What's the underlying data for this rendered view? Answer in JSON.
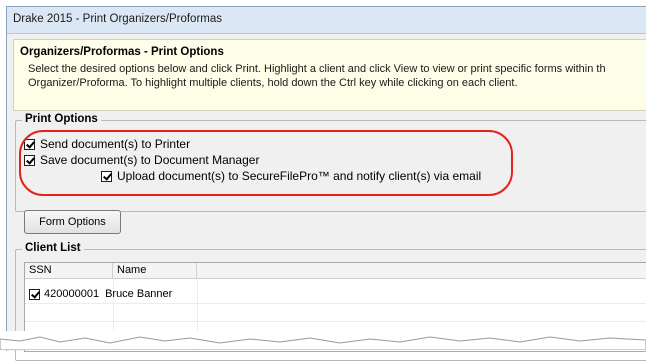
{
  "window": {
    "title": "Drake 2015 - Print Organizers/Proformas"
  },
  "info": {
    "heading": "Organizers/Proformas - Print Options",
    "line1": "Select the desired options below and click Print. Highlight a client and click View to view or print specific forms within th",
    "line2": "Organizer/Proforma. To highlight multiple clients, hold down the Ctrl key while clicking on each client."
  },
  "print_options": {
    "legend": "Print Options",
    "send_to_printer": {
      "label": "Send document(s) to Printer",
      "checked": true
    },
    "save_to_doc_manager": {
      "label": "Save document(s) to Document Manager",
      "checked": true
    },
    "upload_securefilepro": {
      "label": "Upload document(s) to SecureFilePro™  and notify client(s) via email",
      "checked": true
    }
  },
  "form_options_button": "Form Options",
  "client_list": {
    "legend": "Client List",
    "columns": [
      "SSN",
      "Name"
    ],
    "rows": [
      {
        "checked": true,
        "ssn": "420000001",
        "name": "Bruce Banner"
      }
    ]
  },
  "colors": {
    "highlight_oval": "#e2231a",
    "info_background": "#fefde8"
  }
}
